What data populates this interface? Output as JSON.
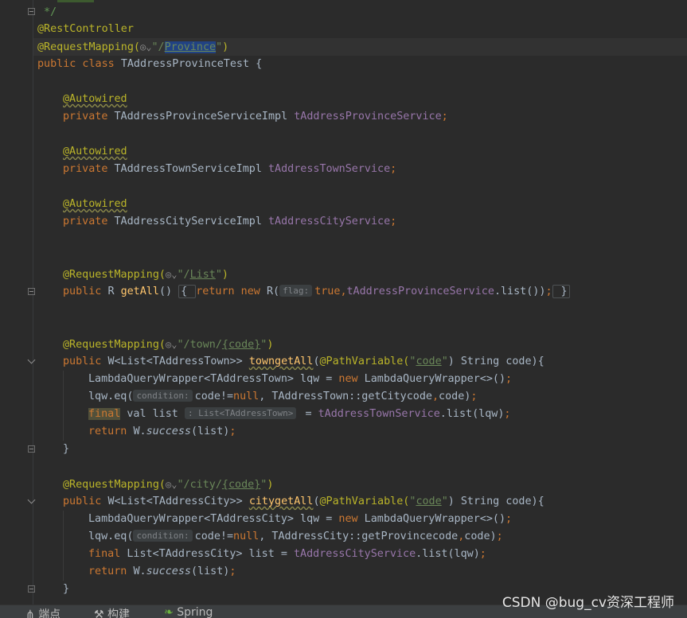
{
  "editor": {
    "lines": {
      "l00": "*/",
      "l01_ann": "@RestController",
      "l02_ann": "@RequestMapping(",
      "l02_str_open": "\"/",
      "l02_url": "Province",
      "l02_str_close": "\"",
      "l02_end": ")",
      "l03_kw": "public class ",
      "l03_rest": "TAddressProvinceTest {",
      "l05_ann": "@Autowired",
      "l06_kw": "private ",
      "l06_type": "TAddressProvinceServiceImpl ",
      "l06_fld": "tAddressProvinceService",
      "l06_semi": ";",
      "l08_ann": "@Autowired",
      "l09_kw": "private ",
      "l09_type": "TAddressTownServiceImpl ",
      "l09_fld": "tAddressTownService",
      "l09_semi": ";",
      "l11_ann": "@Autowired",
      "l12_kw": "private ",
      "l12_type": "TAddressCityServiceImpl ",
      "l12_fld": "tAddressCityService",
      "l12_semi": ";",
      "l15_ann": "@RequestMapping(",
      "l15_str_open": "\"/",
      "l15_url": "List",
      "l15_str_close": "\"",
      "l15_end": ")",
      "l16_kw": "public ",
      "l16_type": "R ",
      "l16_fn": "getAll",
      "l16_paren": "() ",
      "l16_open": "{ ",
      "l16_kw2": "return new ",
      "l16_r": "R(",
      "l16_hint": "flag:",
      "l16_true": "true",
      "l16_comma": ",",
      "l16_fld": "tAddressProvinceService",
      "l16_call": ".list())",
      "l16_semi": ";",
      "l16_close": " }",
      "l19_ann": "@RequestMapping(",
      "l19_str_open": "\"/town/",
      "l19_url": "{code}",
      "l19_str_close": "\"",
      "l19_end": ")",
      "l20_kw": "public ",
      "l20_type": "W<List<TAddressTown>> ",
      "l20_fn": "towngetAll",
      "l20_p1": "(",
      "l20_ann": "@PathVariable(",
      "l20_str_open": "\"",
      "l20_str_url": "code",
      "l20_str_close": "\"",
      "l20_rest": ") String code){",
      "l21_a": "LambdaQueryWrapper<TAddressTown> lqw = ",
      "l21_kw": "new ",
      "l21_b": "LambdaQueryWrapper<>()",
      "l21_semi": ";",
      "l22_a": "lqw.eq(",
      "l22_hint": "condition:",
      "l22_b": "code!=",
      "l22_kw": "null",
      "l22_c": ", TAddressTown::getCitycode",
      "l22_comma": ",",
      "l22_d": "code)",
      "l22_semi": ";",
      "l23_kw1": "final",
      "l23_kw2": " val ",
      "l23_a": "list ",
      "l23_hint": ": List<TAddressTown>",
      "l23_b": " = ",
      "l23_fld": "tAddressTownService",
      "l23_c": ".list(lqw)",
      "l23_semi": ";",
      "l24_kw": "return ",
      "l24_a": "W.",
      "l24_it": "success",
      "l24_b": "(list)",
      "l24_semi": ";",
      "l25": "}",
      "l27_ann": "@RequestMapping(",
      "l27_str_open": "\"/city/",
      "l27_url": "{code}",
      "l27_str_close": "\"",
      "l27_end": ")",
      "l28_kw": "public ",
      "l28_type": "W<List<TAddressCity>> ",
      "l28_fn": "citygetAll",
      "l28_p1": "(",
      "l28_ann": "@PathVariable(",
      "l28_str_open": "\"",
      "l28_str_url": "code",
      "l28_str_close": "\"",
      "l28_rest": ") String code){",
      "l29_a": "LambdaQueryWrapper<TAddressCity> lqw = ",
      "l29_kw": "new ",
      "l29_b": "LambdaQueryWrapper<>()",
      "l29_semi": ";",
      "l30_a": "lqw.eq(",
      "l30_hint": "condition:",
      "l30_b": "code!=",
      "l30_kw": "null",
      "l30_c": ", TAddressCity::getProvincecode",
      "l30_comma": ",",
      "l30_d": "code)",
      "l30_semi": ";",
      "l31_kw": "final ",
      "l31_a": "List<TAddressCity> list = ",
      "l31_fld": "tAddressCityService",
      "l31_b": ".list(lqw)",
      "l31_semi": ";",
      "l32_kw": "return ",
      "l32_a": "W.",
      "l32_it": "success",
      "l32_b": "(list)",
      "l32_semi": ";",
      "l33": "}"
    },
    "globe_icon": "globe-icon",
    "colors": {
      "background": "#2b2b2b",
      "keyword": "#cc7832",
      "annotation": "#bbb529",
      "string": "#6a8759",
      "field": "#9876aa",
      "method": "#ffc66d",
      "plain": "#a9b7c6"
    }
  },
  "statusbar": {
    "endpoints_label": "端点",
    "build_label": "构建",
    "spring_label": "Spring"
  },
  "watermark": "CSDN @bug_cv资深工程师"
}
